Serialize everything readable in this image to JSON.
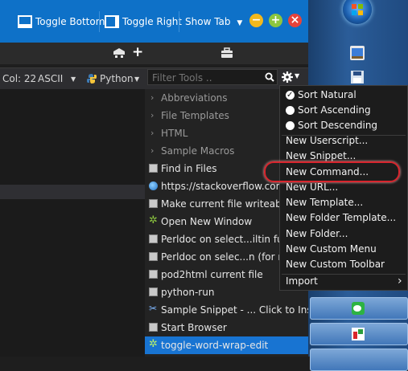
{
  "toolbar": {
    "toggle_bottom": "Toggle Bottom",
    "toggle_right": "Toggle Right",
    "show_tab": "Show Tab",
    "show_tab_arrow": "▼"
  },
  "window_controls": {
    "minimize": "−",
    "maximize": "+",
    "close": "×"
  },
  "status": {
    "col": "Col: 22",
    "encoding": "ASCII",
    "language": "Python",
    "dropdown_arrow": "▼"
  },
  "filter": {
    "placeholder": "Filter Tools .."
  },
  "tools": {
    "folders": [
      "Abbreviations",
      "File Templates",
      "HTML",
      "Sample Macros"
    ],
    "items": [
      {
        "label": "Find in Files",
        "icon": "command-icon"
      },
      {
        "label": "https://stackoverflow.com/",
        "icon": "globe-icon"
      },
      {
        "label": "Make current file writeable",
        "icon": "command-icon"
      },
      {
        "label": "Open New Window",
        "icon": "macro-icon"
      },
      {
        "label": "Perldoc on select...iltin func",
        "icon": "command-icon"
      },
      {
        "label": "Perldoc on selec...n (for mod",
        "icon": "command-icon"
      },
      {
        "label": "pod2html current file",
        "icon": "command-icon"
      },
      {
        "label": "python-run",
        "icon": "command-icon"
      },
      {
        "label": "Sample Snippet - ... Click to Insert",
        "icon": "scissors-icon"
      },
      {
        "label": "Start Browser",
        "icon": "command-icon"
      },
      {
        "label": "toggle-word-wrap-edit",
        "icon": "macro-icon",
        "selected": true
      }
    ]
  },
  "menu": {
    "sort": [
      {
        "label": "Sort Natural",
        "checked": true
      },
      {
        "label": "Sort Ascending",
        "checked": false
      },
      {
        "label": "Sort Descending",
        "checked": false
      }
    ],
    "new_items": [
      "New Userscript...",
      "New Snippet...",
      "New Command...",
      "New URL...",
      "New Template...",
      "New Folder Template...",
      "New Folder...",
      "New Custom Menu",
      "New Custom Toolbar"
    ],
    "import": "Import",
    "import_arrow": "›"
  },
  "colors": {
    "accent": "#1874d2",
    "titlebar": "#0e71c8",
    "highlight_ring": "#d8262e"
  }
}
